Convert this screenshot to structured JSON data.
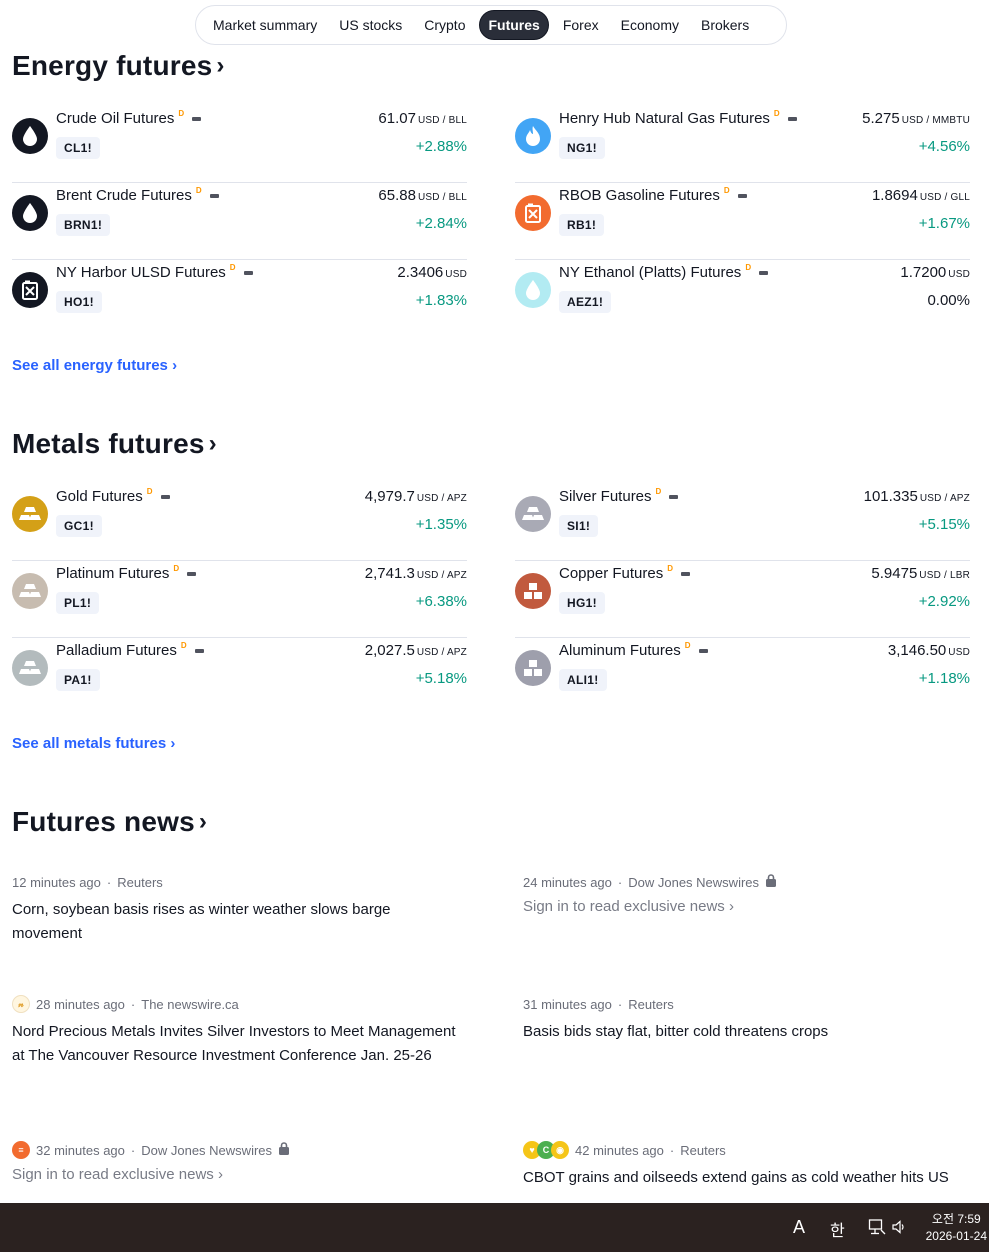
{
  "tabs": [
    "Market summary",
    "US stocks",
    "Crypto",
    "Futures",
    "Forex",
    "Economy",
    "Brokers"
  ],
  "active_tab": "Futures",
  "energy": {
    "title": "Energy futures",
    "see_all": "See all energy futures",
    "items": [
      {
        "name": "Crude Oil Futures",
        "symbol": "CL1!",
        "price": "61.07",
        "unit": "USD / BLL",
        "change": "+2.88%",
        "icon": "oil-drop-icon",
        "color": "#131722"
      },
      {
        "name": "Henry Hub Natural Gas Futures",
        "symbol": "NG1!",
        "price": "5.275",
        "unit": "USD / MMBTU",
        "change": "+4.56%",
        "icon": "flame-icon",
        "color": "#42a5f5"
      },
      {
        "name": "Brent Crude Futures",
        "symbol": "BRN1!",
        "price": "65.88",
        "unit": "USD / BLL",
        "change": "+2.84%",
        "icon": "oil-drop-icon",
        "color": "#131722"
      },
      {
        "name": "RBOB Gasoline Futures",
        "symbol": "RB1!",
        "price": "1.8694",
        "unit": "USD / GLL",
        "change": "+1.67%",
        "icon": "fuel-can-icon",
        "color": "#f26b2f"
      },
      {
        "name": "NY Harbor ULSD Futures",
        "symbol": "HO1!",
        "price": "2.3406",
        "unit": "USD",
        "change": "+1.83%",
        "icon": "fuel-can-icon",
        "color": "#131722"
      },
      {
        "name": "NY Ethanol (Platts) Futures",
        "symbol": "AEZ1!",
        "price": "1.7200",
        "unit": "USD",
        "change": "0.00%",
        "icon": "drop-icon",
        "color": "#b2ebf2"
      }
    ]
  },
  "metals": {
    "title": "Metals futures",
    "see_all": "See all metals futures",
    "items": [
      {
        "name": "Gold Futures",
        "symbol": "GC1!",
        "price": "4,979.7",
        "unit": "USD / APZ",
        "change": "+1.35%",
        "icon": "bars-icon",
        "color": "#d4a017"
      },
      {
        "name": "Silver Futures",
        "symbol": "SI1!",
        "price": "101.335",
        "unit": "USD / APZ",
        "change": "+5.15%",
        "icon": "bars-icon",
        "color": "#a9aab5"
      },
      {
        "name": "Platinum Futures",
        "symbol": "PL1!",
        "price": "2,741.3",
        "unit": "USD / APZ",
        "change": "+6.38%",
        "icon": "bars-icon",
        "color": "#c7bcb0"
      },
      {
        "name": "Copper Futures",
        "symbol": "HG1!",
        "price": "5.9475",
        "unit": "USD / LBR",
        "change": "+2.92%",
        "icon": "blocks-icon",
        "color": "#c15a3e"
      },
      {
        "name": "Palladium Futures",
        "symbol": "PA1!",
        "price": "2,027.5",
        "unit": "USD / APZ",
        "change": "+5.18%",
        "icon": "bars-icon",
        "color": "#b3bbbd"
      },
      {
        "name": "Aluminum Futures",
        "symbol": "ALI1!",
        "price": "3,146.50",
        "unit": "USD",
        "change": "+1.18%",
        "icon": "blocks-icon",
        "color": "#9e9fac"
      }
    ]
  },
  "news": {
    "title": "Futures news",
    "items": [
      {
        "time": "12 minutes ago",
        "source": "Reuters",
        "headline": "Corn, soybean basis rises as winter weather slows barge movement"
      },
      {
        "time": "24 minutes ago",
        "source": "Dow Jones Newswires",
        "locked_text": "Sign in to read exclusive news"
      },
      {
        "time": "28 minutes ago",
        "source": "The newswire.ca",
        "headline": "Nord Precious Metals Invites Silver Investors to Meet Management at The Vancouver Resource Investment Conference Jan. 25-26"
      },
      {
        "time": "31 minutes ago",
        "source": "Reuters",
        "headline": "Basis bids stay flat, bitter cold threatens crops"
      },
      {
        "time": "32 minutes ago",
        "source": "Dow Jones Newswires",
        "locked_text": "Sign in to read exclusive news"
      },
      {
        "time": "42 minutes ago",
        "source": "Reuters",
        "headline": "CBOT grains and oilseeds extend gains as cold weather hits US"
      }
    ]
  },
  "taskbar": {
    "ime_letter": "A",
    "ime_lang": "한",
    "clock_time": "오전 7:59",
    "clock_date": "2026-01-24"
  }
}
